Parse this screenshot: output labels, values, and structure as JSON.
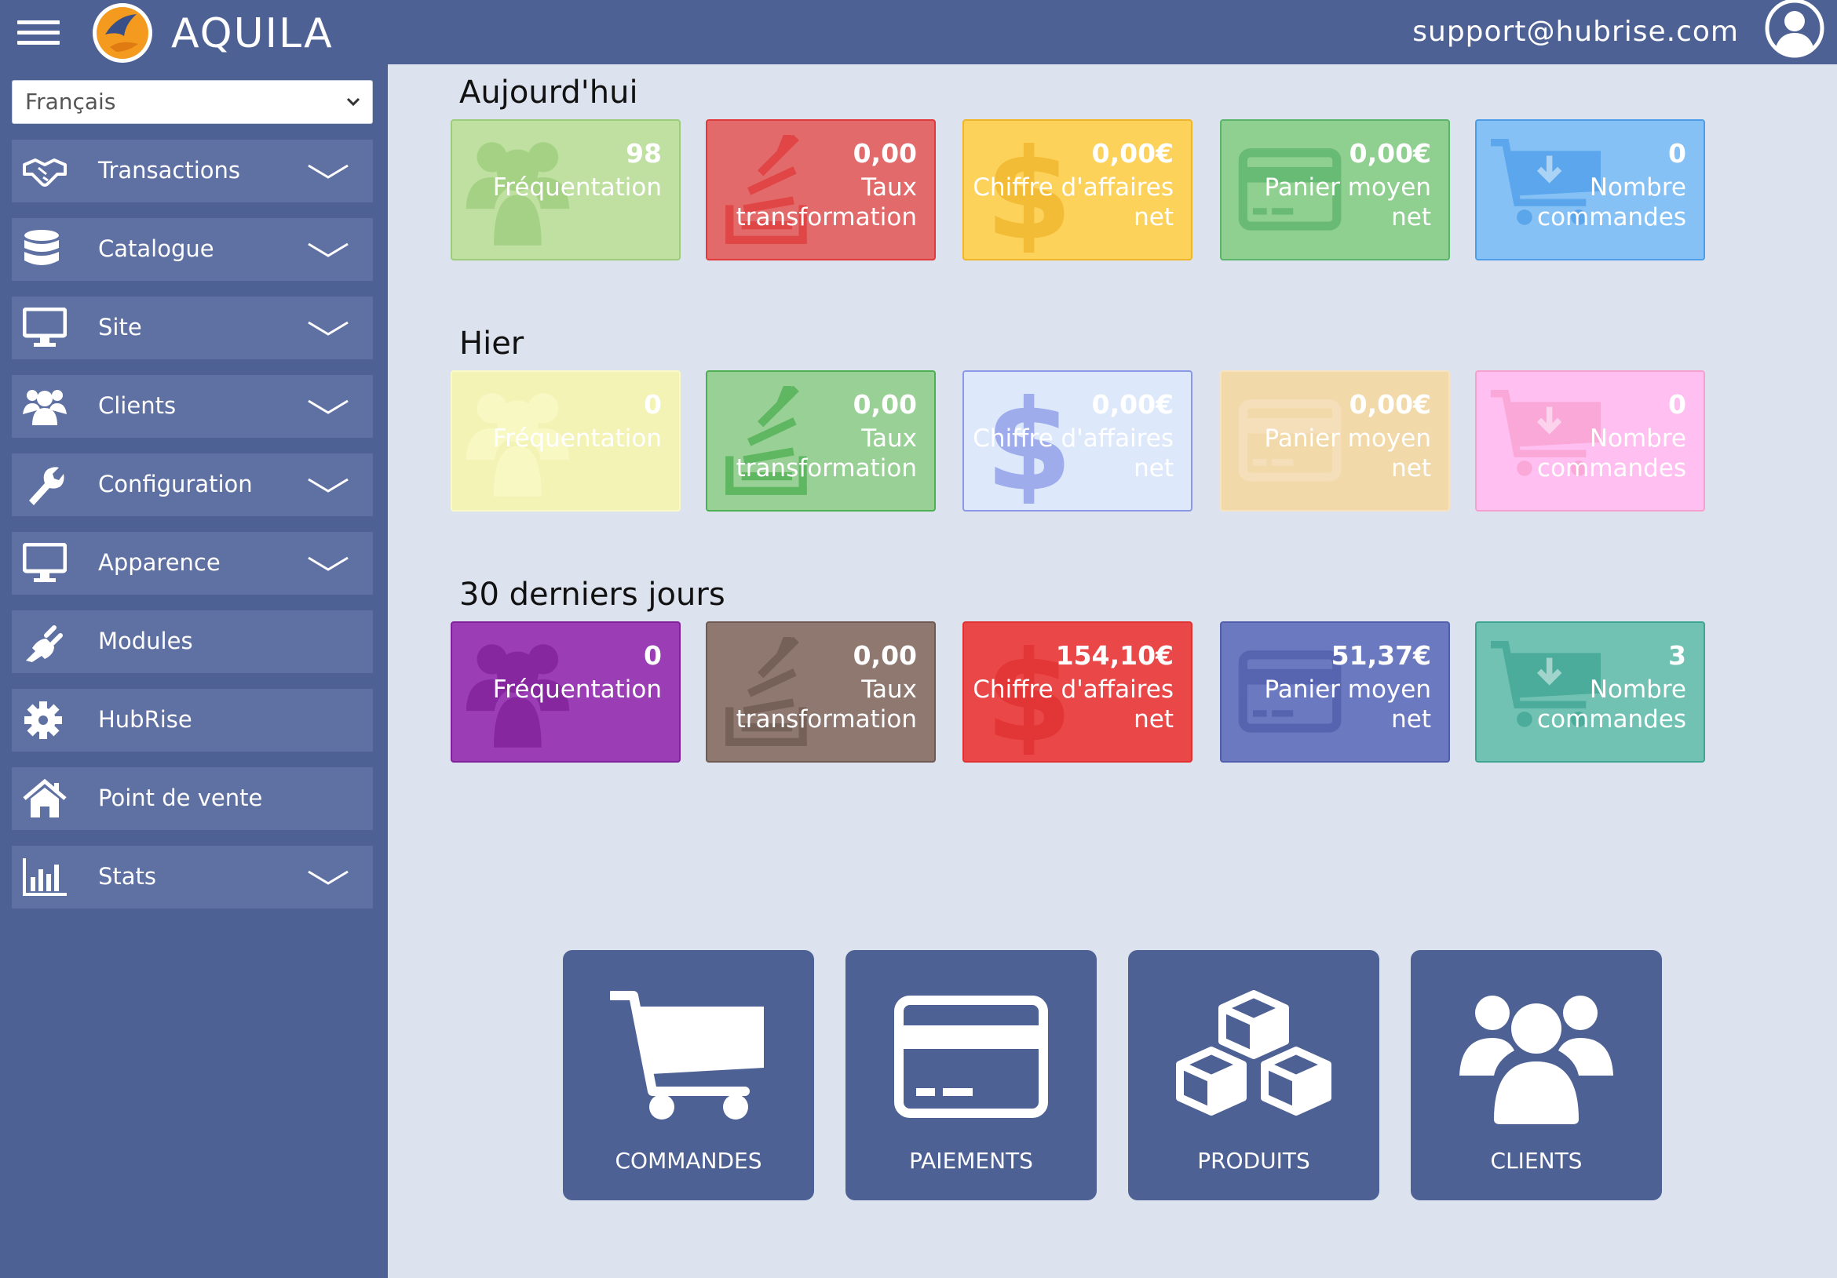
{
  "header": {
    "brand": "AQUILA",
    "user_email": "support@hubrise.com"
  },
  "sidebar": {
    "language": "Français",
    "items": [
      {
        "label": "Transactions",
        "icon": "handshake-icon",
        "expandable": true
      },
      {
        "label": "Catalogue",
        "icon": "database-icon",
        "expandable": true
      },
      {
        "label": "Site",
        "icon": "monitor-icon",
        "expandable": true
      },
      {
        "label": "Clients",
        "icon": "users-icon",
        "expandable": true
      },
      {
        "label": "Configuration",
        "icon": "wrench-icon",
        "expandable": true
      },
      {
        "label": "Apparence",
        "icon": "monitor-icon",
        "expandable": true
      },
      {
        "label": "Modules",
        "icon": "plug-icon",
        "expandable": false
      },
      {
        "label": "HubRise",
        "icon": "gear-icon",
        "expandable": false
      },
      {
        "label": "Point de vente",
        "icon": "home-icon",
        "expandable": false
      },
      {
        "label": "Stats",
        "icon": "bar-chart-icon",
        "expandable": true
      }
    ]
  },
  "sections": [
    {
      "title": "Aujourd'hui",
      "cards": [
        {
          "value": "98",
          "label": "Fréquentation",
          "color": "#bfe0a1",
          "icon_color": "#9ccd7c"
        },
        {
          "value": "0,00",
          "label": "Taux transformation",
          "color": "#e26a6a",
          "icon_color": "#e03a3a"
        },
        {
          "value": "0,00€",
          "label": "Chiffre d'affaires net",
          "color": "#fcd25b",
          "icon_color": "#f1b52a"
        },
        {
          "value": "0,00€",
          "label": "Panier moyen net",
          "color": "#8fcf8f",
          "icon_color": "#5bb46b"
        },
        {
          "value": "0",
          "label": "Nombre commandes",
          "color": "#86c1f5",
          "icon_color": "#4d9de8"
        }
      ]
    },
    {
      "title": "Hier",
      "cards": [
        {
          "value": "0",
          "label": "Fréquentation",
          "color": "#f3f3b6",
          "icon_color": "#fafac8"
        },
        {
          "value": "0,00",
          "label": "Taux transformation",
          "color": "#99d096",
          "icon_color": "#4caf50"
        },
        {
          "value": "0,00€",
          "label": "Chiffre d'affaires net",
          "color": "#dde9fb",
          "icon_color": "#8b98e8"
        },
        {
          "value": "0,00€",
          "label": "Panier moyen net",
          "color": "#f2d9a9",
          "icon_color": "#f7e2c2"
        },
        {
          "value": "0",
          "label": "Nombre commandes",
          "color": "#ffc0f1",
          "icon_color": "#f7a0d0"
        }
      ]
    },
    {
      "title": "30 derniers jours",
      "cards": [
        {
          "value": "0",
          "label": "Fréquentation",
          "color": "#9b3db5",
          "icon_color": "#80209a"
        },
        {
          "value": "0,00",
          "label": "Taux transformation",
          "color": "#8e7870",
          "icon_color": "#6e5a52"
        },
        {
          "value": "154,10€",
          "label": "Chiffre d'affaires net",
          "color": "#ea4848",
          "icon_color": "#e03030"
        },
        {
          "value": "51,37€",
          "label": "Panier moyen net",
          "color": "#6b79c0",
          "icon_color": "#505eab"
        },
        {
          "value": "3",
          "label": "Nombre commandes",
          "color": "#72c2b4",
          "icon_color": "#3fa593"
        }
      ]
    }
  ],
  "tiles": [
    {
      "label": "COMMANDES",
      "icon": "cart-icon"
    },
    {
      "label": "PAIEMENTS",
      "icon": "credit-card-icon"
    },
    {
      "label": "PRODUITS",
      "icon": "cubes-icon"
    },
    {
      "label": "CLIENTS",
      "icon": "users-icon"
    }
  ],
  "colors": {
    "primary": "#4e6194",
    "sidebar_item": "#5f71a3",
    "background": "#dde3ee"
  }
}
